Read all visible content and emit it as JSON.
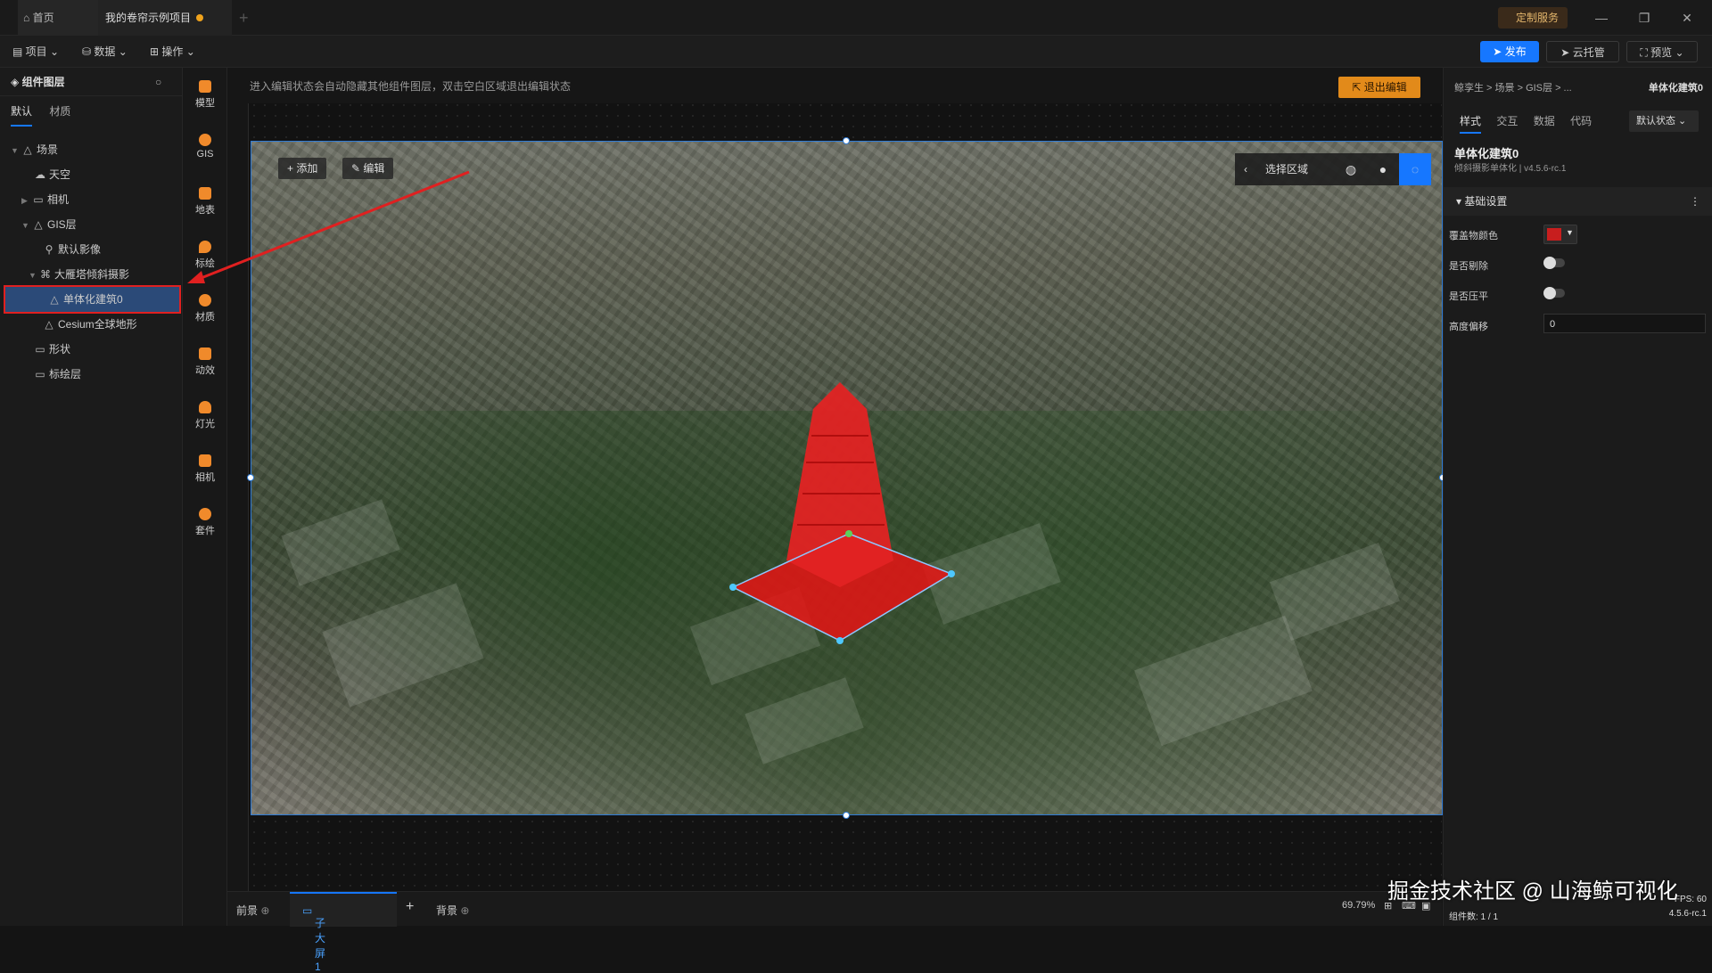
{
  "tabs": {
    "home": "首页",
    "project": "我的卷帘示例项目"
  },
  "topbar": {
    "custom_service": "定制服务"
  },
  "menu": {
    "project": "项目",
    "data": "数据",
    "operate": "操作",
    "publish": "发布",
    "cloud_host": "云托管",
    "preview": "预览"
  },
  "left_panel": {
    "title": "组件图层",
    "tab_default": "默认",
    "tab_material": "材质",
    "tree": [
      {
        "label": "场景"
      },
      {
        "label": "天空"
      },
      {
        "label": "相机"
      },
      {
        "label": "GIS层"
      },
      {
        "label": "默认影像"
      },
      {
        "label": "大雁塔倾斜摄影"
      },
      {
        "label": "单体化建筑0"
      },
      {
        "label": "Cesium全球地形"
      },
      {
        "label": "形状"
      },
      {
        "label": "标绘层"
      }
    ]
  },
  "side_toolbar": [
    "模型",
    "GIS",
    "地表",
    "标绘",
    "材质",
    "动效",
    "灯光",
    "相机",
    "套件"
  ],
  "canvas": {
    "hint": "进入编辑状态会自动隐藏其他组件图层，双击空白区域退出编辑状态",
    "exit_edit": "退出编辑",
    "add": "添加",
    "edit": "编辑",
    "select_area": "选择区域"
  },
  "right_panel": {
    "breadcrumb": "鲸孪生 > 场景 > GIS层 > ...",
    "breadcrumb_right": "单体化建筑0",
    "tab_style": "样式",
    "tab_interact": "交互",
    "tab_data": "数据",
    "tab_code": "代码",
    "state": "默认状态",
    "title": "单体化建筑0",
    "subtitle": "倾斜摄影单体化 | v4.5.6-rc.1",
    "section": "基础设置",
    "color_label": "覆盖物颜色",
    "color_value": "#c81e1e",
    "exclude_label": "是否剔除",
    "flatten_label": "是否压平",
    "height_label": "高度偏移",
    "height_value": "0"
  },
  "bottombar": {
    "foreground": "前景",
    "sub_screen": "子大屏1",
    "background": "背景",
    "zoom": "69.79%"
  },
  "status": {
    "components": "组件数: 1 / 1",
    "version": "4.5.6-rc.1",
    "fps": "60"
  },
  "watermark": "掘金技术社区 @ 山海鲸可视化"
}
